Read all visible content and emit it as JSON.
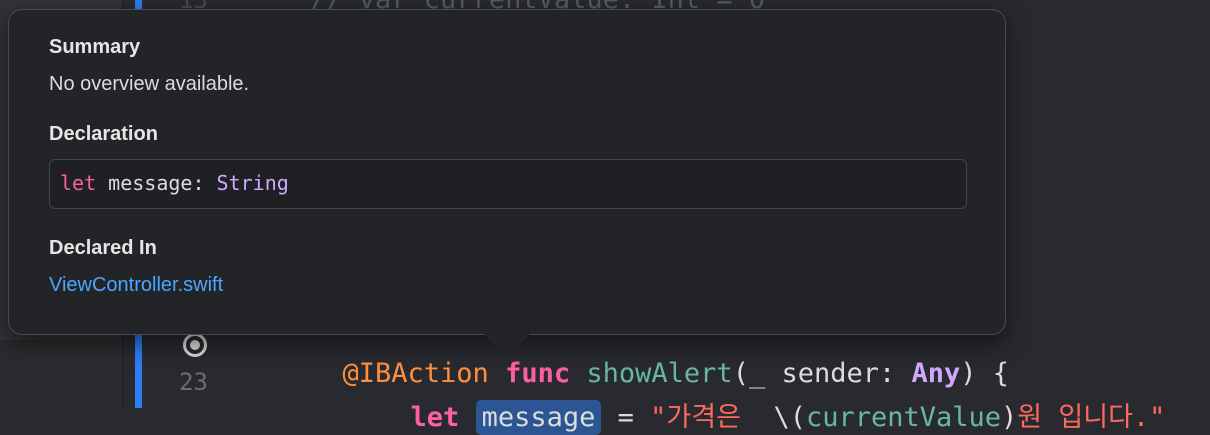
{
  "editor": {
    "lines": [
      {
        "number": "13",
        "text": "// var currentValue: Int = 0"
      },
      {
        "number": "",
        "attr": "@IBAction",
        "kw": "func",
        "fn": "showAlert",
        "params": "(_ sender: ",
        "type": "Any",
        "tail": ") {"
      },
      {
        "number": "23",
        "kw": "let",
        "id": "message",
        "eq": " = ",
        "str_open": "\"가격은  ",
        "interp_open": "\\(",
        "interp_id": "currentValue",
        "interp_close": ")",
        "str_close": "원 입니다.\""
      }
    ]
  },
  "popover": {
    "summary_heading": "Summary",
    "summary_text": "No overview available.",
    "declaration_heading": "Declaration",
    "declaration": {
      "kw": "let",
      "name": " message: ",
      "type": "String"
    },
    "declared_in_heading": "Declared In",
    "declared_in_link": "ViewController.swift"
  },
  "colors": {
    "keyword": "#fc5fa3",
    "type": "#d0a8ff",
    "string": "#fc6a5d",
    "function": "#67b7a4",
    "link": "#4aa6ff",
    "accent_bar": "#2f7cf6",
    "highlight": "#2c5594"
  },
  "icons": {
    "breakpoint": "breakpoint-circle-icon"
  }
}
